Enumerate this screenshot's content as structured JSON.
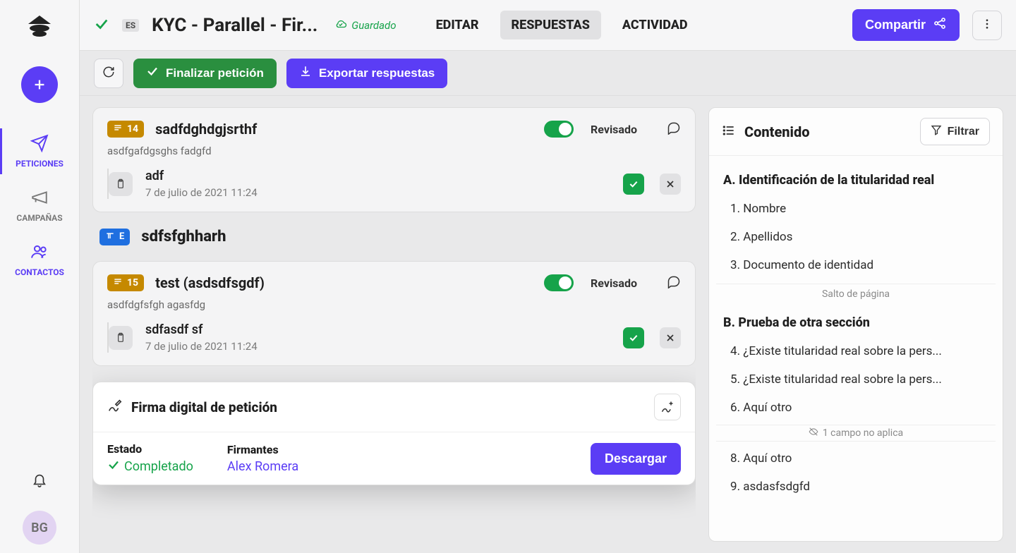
{
  "rail": {
    "items": [
      "PETICIONES",
      "CAMPAÑAS",
      "CONTACTOS"
    ],
    "avatar": "BG"
  },
  "topbar": {
    "lang": "ES",
    "title": "KYC - Parallel - Fir...",
    "saved": "Guardado",
    "tabs": [
      "EDITAR",
      "RESPUESTAS",
      "ACTIVIDAD"
    ],
    "activeTab": 1,
    "share": "Compartir"
  },
  "actions": {
    "finalize": "Finalizar petición",
    "export": "Exportar respuestas"
  },
  "questions": [
    {
      "number": "14",
      "title": "sadfdghdgjsrthf",
      "sub": "asdfgafdgsghs fadgfd",
      "reviewed_label": "Revisado",
      "answer": "adf",
      "date": "7 de julio de 2021 11:24"
    },
    {
      "number": "15",
      "title": "test (asdsdfsgdf)",
      "sub": "asdfdgfsfgh agasfdg",
      "reviewed_label": "Revisado",
      "answer": "sdfasdf sf",
      "date": "7 de julio de 2021 11:24"
    }
  ],
  "section": {
    "badge": "E",
    "title": "sdfsfghharh"
  },
  "signature": {
    "heading": "Firma digital de petición",
    "state_label": "Estado",
    "state_value": "Completado",
    "signers_label": "Firmantes",
    "signer": "Alex Romera",
    "download": "Descargar"
  },
  "toc": {
    "heading": "Contenido",
    "filter": "Filtrar",
    "sections": [
      {
        "letter": "A",
        "title": "Identificación de la titularidad real",
        "items": [
          {
            "n": "1",
            "label": "Nombre"
          },
          {
            "n": "2",
            "label": "Apellidos"
          },
          {
            "n": "3",
            "label": "Documento de identidad"
          }
        ],
        "page_break": "Salto de página"
      },
      {
        "letter": "B",
        "title": "Prueba de otra sección",
        "items": [
          {
            "n": "4",
            "label": "¿Existe titularidad real sobre la pers..."
          },
          {
            "n": "5",
            "label": "¿Existe titularidad real sobre la pers..."
          },
          {
            "n": "6",
            "label": "Aquí otro"
          }
        ],
        "hidden_note": "1 campo no aplica",
        "items_after": [
          {
            "n": "8",
            "label": "Aquí otro"
          },
          {
            "n": "9",
            "label": "asdasfsdgfd"
          }
        ]
      }
    ]
  }
}
